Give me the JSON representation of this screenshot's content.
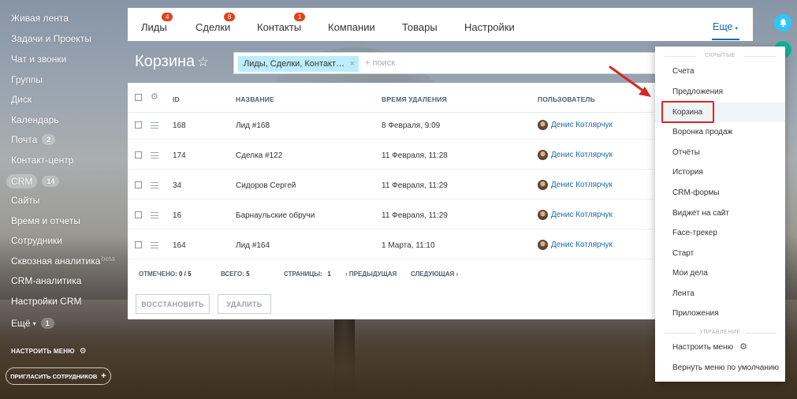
{
  "left_menu": {
    "items": [
      {
        "label": "Живая лента"
      },
      {
        "label": "Задачи и Проекты"
      },
      {
        "label": "Чат и звонки"
      },
      {
        "label": "Группы"
      },
      {
        "label": "Диск"
      },
      {
        "label": "Календарь"
      },
      {
        "label": "Почта",
        "count": "2"
      },
      {
        "label": "Контакт-центр"
      },
      {
        "label": "CRM",
        "count": "14"
      },
      {
        "label": "Сайты"
      },
      {
        "label": "Время и отчеты"
      },
      {
        "label": "Сотрудники"
      },
      {
        "label": "Сквозная аналитика",
        "badge": "beta"
      },
      {
        "label": "CRM-аналитика"
      },
      {
        "label": "Настройки CRM"
      },
      {
        "label": "Ещё",
        "count": "1"
      }
    ],
    "configure": "НАСТРОИТЬ МЕНЮ",
    "invite": "ПРИГЛАСИТЬ СОТРУДНИКОВ",
    "invite_icon": "+"
  },
  "topbar": {
    "tabs": [
      {
        "label": "Лиды",
        "badge": "4"
      },
      {
        "label": "Сделки",
        "badge": "8"
      },
      {
        "label": "Контакты",
        "badge": "1"
      },
      {
        "label": "Компании"
      },
      {
        "label": "Товары"
      },
      {
        "label": "Настройки"
      }
    ],
    "more": "Еще"
  },
  "page": {
    "title": "Корзина",
    "star": "☆"
  },
  "filter": {
    "tag": "Лиды, Сделки, Контакт…",
    "tag_close": "×",
    "placeholder": "+ поиск"
  },
  "grid": {
    "columns": [
      "ID",
      "НАЗВАНИЕ",
      "ВРЕМЯ УДАЛЕНИЯ",
      "ПОЛЬЗОВАТЕЛЬ"
    ],
    "rows": [
      {
        "id": "168",
        "name": "Лид #168",
        "time": "8 Февраля, 9:09",
        "user": "Денис Котлярчук"
      },
      {
        "id": "174",
        "name": "Сделка #122",
        "time": "11 Февраля, 11:28",
        "user": "Денис Котлярчук"
      },
      {
        "id": "34",
        "name": "Сидоров Сергей",
        "time": "11 Февраля, 11:29",
        "user": "Денис Котлярчук"
      },
      {
        "id": "16",
        "name": "Барнаульские обручи",
        "time": "11 Февраля, 11:29",
        "user": "Денис Котлярчук"
      },
      {
        "id": "164",
        "name": "Лид #164",
        "time": "1 Марта, 11:10",
        "user": "Денис Котлярчук"
      }
    ],
    "footer": {
      "marked_label": "ОТМЕЧЕНО:",
      "marked_value": "0 / 5",
      "total_label": "ВСЕГО:",
      "total_value": "5",
      "pages_label": "СТРАНИЦЫ:",
      "pages_value": "1",
      "prev": "‹  ПРЕДЫДУЩАЯ",
      "next": "СЛЕДУЮЩАЯ  ›"
    },
    "buttons": {
      "restore": "ВОССТАНОВИТЬ",
      "delete": "УДАЛИТЬ"
    }
  },
  "dropdown": {
    "hidden_label": "СКРЫТЫЕ",
    "items": [
      {
        "label": "Счета"
      },
      {
        "label": "Предложения"
      },
      {
        "label": "Корзина"
      },
      {
        "label": "Воронка продаж"
      },
      {
        "label": "Отчёты"
      },
      {
        "label": "История"
      },
      {
        "label": "CRM-формы"
      },
      {
        "label": "Виджет на сайт"
      },
      {
        "label": "Face-трекер"
      },
      {
        "label": "Старт"
      },
      {
        "label": "Мои дела"
      },
      {
        "label": "Лента"
      },
      {
        "label": "Приложения"
      }
    ],
    "management_label": "УПРАВЛЕНИЕ",
    "configure": "Настроить меню",
    "reset": "Вернуть меню по умолчанию"
  },
  "colors": {
    "accent": "#2067b0",
    "badge": "#e0441b",
    "highlight": "#d72626",
    "filter_tag": "#bcedfc",
    "bell": "#2fc6f6"
  }
}
